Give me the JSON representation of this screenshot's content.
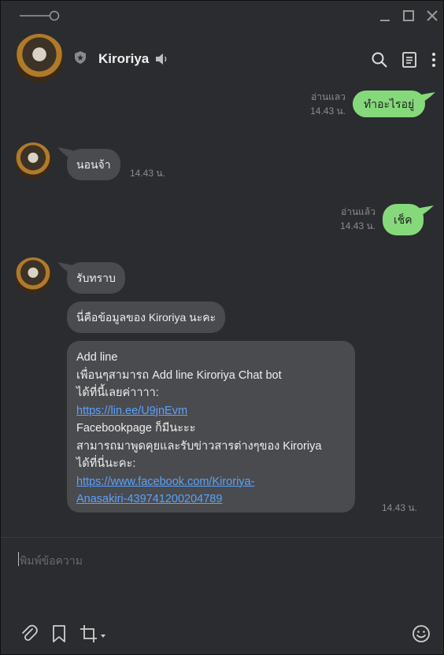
{
  "window": {
    "colors": {
      "background": "#2b2c2f",
      "outgoing_bubble": "#86d97b",
      "incoming_bubble": "#4a4b4e",
      "link": "#5aa2ff"
    }
  },
  "header": {
    "name": "Kiroriya",
    "icons": [
      "shield-icon",
      "speaker-icon",
      "search-icon",
      "notes-icon",
      "more-icon"
    ]
  },
  "messages": [
    {
      "dir": "out",
      "text": "ทำอะไรอยู่",
      "read": "อ่านแลว",
      "time": "14.43 น."
    },
    {
      "dir": "in",
      "text": "นอนจ้า",
      "time": "14.43 น."
    },
    {
      "dir": "out",
      "text": "เช็ค",
      "read": "อ่านแล้ว",
      "time": "14.43 น."
    },
    {
      "dir": "in",
      "text": "รับทราบ"
    },
    {
      "dir": "in",
      "text": "นี่คือข้อมูลของ Kiroriya นะคะ"
    },
    {
      "dir": "in",
      "lines": [
        "Add line",
        "เพื่อนๆสามารถ Add line Kiroriya Chat bot",
        "ได้ที่นี้เลยค่าาาา:",
        "https://lin.ee/U9jnEvm",
        "Facebookpage ก็มีนะะะ",
        "สามารถมาพูดคุยและรับข่าวสารต่างๆของ Kiroriya",
        "ได้ที่นี่นะคะ:",
        "https://www.facebook.com/Kiroriya-",
        "Anasakiri-439741200204789"
      ],
      "time": "14.43 น."
    }
  ],
  "composer": {
    "placeholder": "พิมพ์ข้อความ",
    "icons": [
      "attach-icon",
      "bookmark-icon",
      "crop-icon",
      "emoji-icon"
    ]
  }
}
